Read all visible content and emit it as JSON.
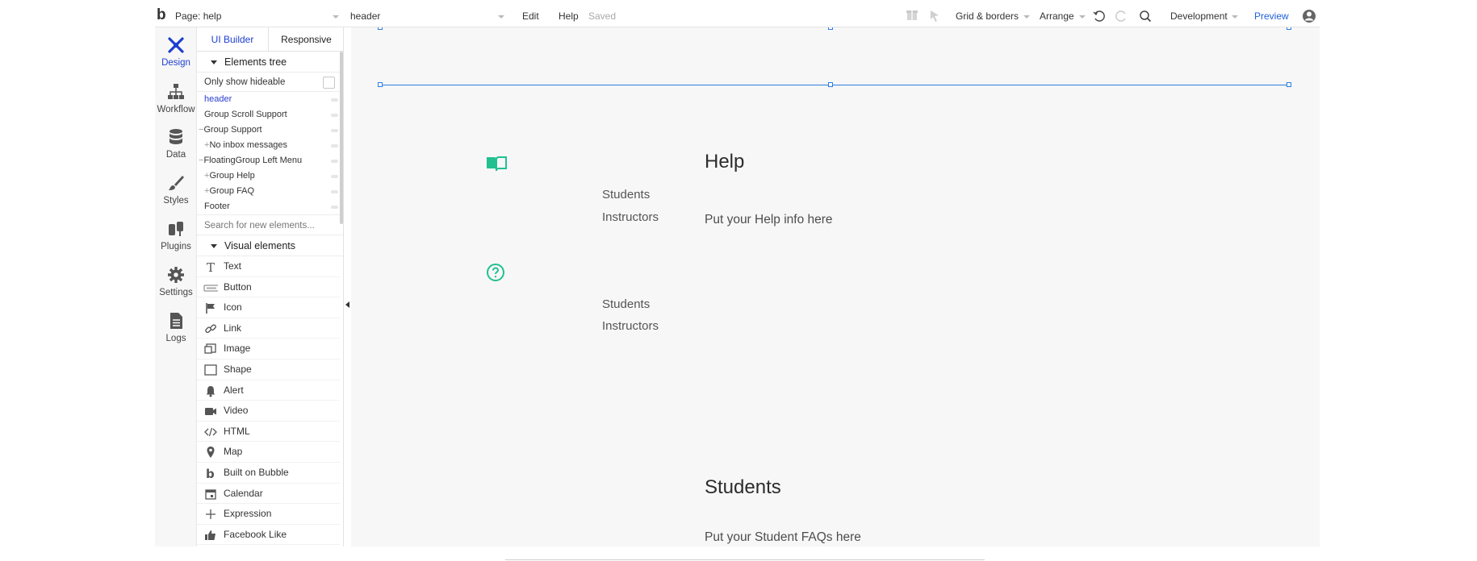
{
  "topbar": {
    "logo": "b",
    "page_label": "Page: help",
    "element_selector": "header",
    "menu_edit": "Edit",
    "menu_help": "Help",
    "status": "Saved",
    "grid_borders": "Grid & borders",
    "arrange": "Arrange",
    "environment": "Development",
    "preview": "Preview"
  },
  "leftnav": {
    "items": [
      {
        "label": "Design",
        "icon": "design-icon"
      },
      {
        "label": "Workflow",
        "icon": "workflow-icon"
      },
      {
        "label": "Data",
        "icon": "database-icon"
      },
      {
        "label": "Styles",
        "icon": "brush-icon"
      },
      {
        "label": "Plugins",
        "icon": "plug-icon"
      },
      {
        "label": "Settings",
        "icon": "gear-icon"
      },
      {
        "label": "Logs",
        "icon": "document-icon"
      }
    ]
  },
  "panel": {
    "tabs": [
      "UI Builder",
      "Responsive"
    ],
    "elements_tree_title": "Elements tree",
    "only_show_hideable": "Only show hideable",
    "tree": [
      {
        "label": "header",
        "prefix": ""
      },
      {
        "label": "Group Scroll Support",
        "prefix": ""
      },
      {
        "label": "Group Support",
        "prefix": "−"
      },
      {
        "label": "No inbox messages",
        "prefix": "+"
      },
      {
        "label": "FloatingGroup Left Menu",
        "prefix": "−"
      },
      {
        "label": "Group Help",
        "prefix": "+"
      },
      {
        "label": "Group FAQ",
        "prefix": "+"
      },
      {
        "label": "Footer",
        "prefix": ""
      }
    ],
    "search_placeholder": "Search for new elements...",
    "visual_elements_title": "Visual elements",
    "visual_elements": [
      {
        "label": "Text",
        "icon": "text-icon"
      },
      {
        "label": "Button",
        "icon": "button-icon"
      },
      {
        "label": "Icon",
        "icon": "flag-icon"
      },
      {
        "label": "Link",
        "icon": "link-icon"
      },
      {
        "label": "Image",
        "icon": "image-icon"
      },
      {
        "label": "Shape",
        "icon": "shape-icon"
      },
      {
        "label": "Alert",
        "icon": "bell-icon"
      },
      {
        "label": "Video",
        "icon": "video-icon"
      },
      {
        "label": "HTML",
        "icon": "code-icon"
      },
      {
        "label": "Map",
        "icon": "map-pin-icon"
      },
      {
        "label": "Built on Bubble",
        "icon": "bubble-logo-icon"
      },
      {
        "label": "Calendar",
        "icon": "calendar-icon"
      },
      {
        "label": "Expression",
        "icon": "plus-icon"
      },
      {
        "label": "Facebook Like",
        "icon": "thumbs-up-icon"
      }
    ]
  },
  "canvas": {
    "menu_top": [
      "Students",
      "Instructors"
    ],
    "menu_bottom": [
      "Students",
      "Instructors"
    ],
    "help_title": "Help",
    "help_body": "Put your Help info here",
    "students_title": "Students",
    "students_body": "Put your Student FAQs here"
  },
  "colors": {
    "accent_blue": "#1f3fd0",
    "selection_blue": "#2d7de0",
    "green": "#22c08f"
  }
}
